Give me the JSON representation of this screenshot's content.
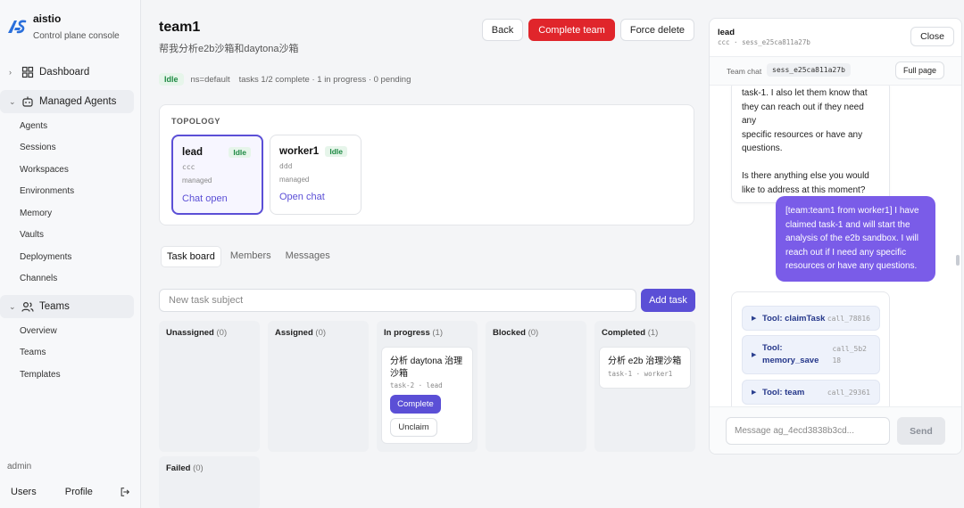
{
  "brand": {
    "name": "aistio",
    "subtitle": "Control plane console"
  },
  "sidebar": {
    "dashboard": "Dashboard",
    "managed_agents": {
      "label": "Managed Agents",
      "items": [
        "Agents",
        "Sessions",
        "Workspaces",
        "Environments",
        "Memory",
        "Vaults",
        "Deployments",
        "Channels"
      ]
    },
    "teams": {
      "label": "Teams",
      "items": [
        "Overview",
        "Teams",
        "Templates"
      ]
    },
    "user_label": "admin",
    "users": "Users",
    "profile": "Profile"
  },
  "header": {
    "title": "team1",
    "subtitle": "帮我分析e2b沙箱和daytona沙箱",
    "back": "Back",
    "complete_team": "Complete team",
    "force_delete": "Force delete",
    "status_badge": "Idle",
    "namespace": "ns=default",
    "tasks_summary": "tasks 1/2 complete · 1 in progress · 0 pending"
  },
  "topology": {
    "title": "TOPOLOGY",
    "agents": [
      {
        "name": "lead",
        "status": "Idle",
        "env": "ccc",
        "kind": "managed",
        "link": "Chat open"
      },
      {
        "name": "worker1",
        "status": "Idle",
        "env": "ddd",
        "kind": "managed",
        "link": "Open chat"
      }
    ]
  },
  "tabs": [
    "Task board",
    "Members",
    "Messages"
  ],
  "task_input": {
    "placeholder": "New task subject",
    "add_label": "Add task"
  },
  "board": {
    "columns": [
      {
        "name": "Unassigned",
        "count": "(0)"
      },
      {
        "name": "Assigned",
        "count": "(0)"
      },
      {
        "name": "In progress",
        "count": "(1)"
      },
      {
        "name": "Blocked",
        "count": "(0)"
      },
      {
        "name": "Completed",
        "count": "(1)"
      },
      {
        "name": "Failed",
        "count": "(0)"
      }
    ],
    "in_progress_task": {
      "title": "分析 daytona 治理沙箱",
      "meta": "task-2 · lead",
      "complete": "Complete",
      "unclaim": "Unclaim"
    },
    "completed_task": {
      "title": "分析 e2b 治理沙箱",
      "meta": "task-1 · worker1"
    }
  },
  "panel": {
    "title": "lead",
    "meta": "ccc · sess_e25ca811a27b",
    "close": "Close",
    "team_chat": "Team chat",
    "session_chip": "sess_e25ca811a27b",
    "full_page": "Full page",
    "msg_left": [
      "task-1. I also let them know that",
      "they can reach out if they need any",
      "specific resources or have any",
      "questions.",
      "",
      "Is there anything else you would",
      "like to address at this moment?"
    ],
    "msg_right": "[team:team1 from worker1] I have claimed task-1 and will start the analysis of the e2b sandbox. I will reach out if I need any specific resources or have any questions.",
    "tools": [
      {
        "name": "Tool: claimTask",
        "call": "call_78816"
      },
      {
        "name_l1": "Tool:",
        "name_l2": "memory_save",
        "call_l1": "call_5b2",
        "call_l2": "18"
      },
      {
        "name": "Tool: team",
        "call": "call_29361"
      }
    ],
    "composer_placeholder": "Message ag_4ecd3838b3cd...",
    "send": "Send"
  }
}
